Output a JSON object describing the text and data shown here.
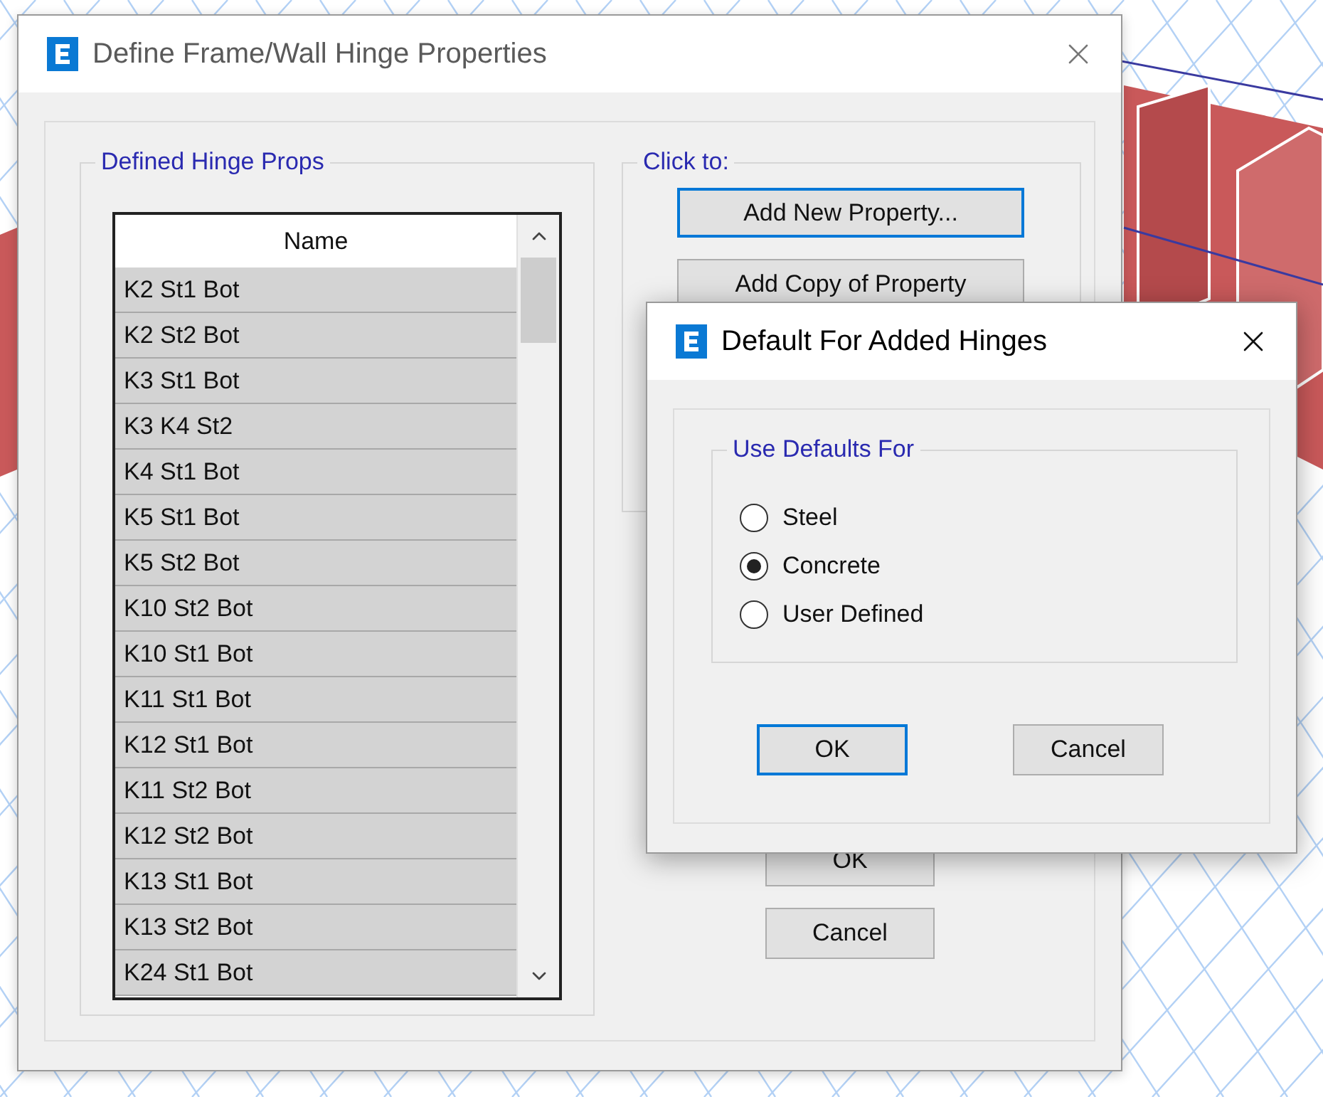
{
  "main_window": {
    "title": "Define Frame/Wall Hinge Properties",
    "hinge_group": {
      "label": "Defined Hinge Props",
      "column": "Name",
      "rows": [
        "K2 St1 Bot",
        "K2 St2 Bot",
        "K3 St1 Bot",
        "K3 K4 St2",
        "K4 St1 Bot",
        "K5 St1 Bot",
        "K5 St2 Bot",
        "K10 St2 Bot",
        "K10 St1 Bot",
        "K11 St1 Bot",
        "K12 St1 Bot",
        "K11 St2 Bot",
        "K12 St2 Bot",
        "K13 St1 Bot",
        "K13 St2 Bot",
        "K24 St1 Bot"
      ]
    },
    "actions_group": {
      "label": "Click to:",
      "buttons": [
        {
          "label": "Add New Property...",
          "focused": true
        },
        {
          "label": "Add Copy of Property",
          "focused": false
        }
      ]
    },
    "buttons": [
      "OK",
      "Cancel"
    ]
  },
  "dialog": {
    "title": "Default For Added Hinges",
    "group": {
      "label": "Use Defaults For",
      "options": [
        {
          "label": "Steel",
          "selected": false
        },
        {
          "label": "Concrete",
          "selected": true
        },
        {
          "label": "User Defined",
          "selected": false
        }
      ]
    },
    "buttons": [
      {
        "label": "OK",
        "focused": true
      },
      {
        "label": "Cancel",
        "focused": false
      }
    ]
  }
}
